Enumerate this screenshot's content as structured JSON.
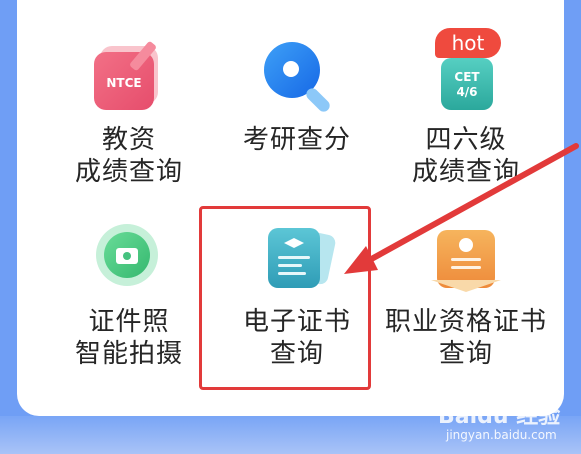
{
  "items": [
    {
      "id": "teacher-score",
      "line1": "教资",
      "line2": "成绩查询",
      "icon": "ntce-icon",
      "icon_text": "NTCE"
    },
    {
      "id": "grad-exam-score",
      "line1": "考研查分",
      "line2": "",
      "icon": "search-icon"
    },
    {
      "id": "cet-score",
      "line1": "四六级",
      "line2": "成绩查询",
      "icon": "cet-icon",
      "icon_text1": "CET",
      "icon_text2": "4/6",
      "badge": "hot"
    },
    {
      "id": "id-photo",
      "line1": "证件照",
      "line2": "智能拍摄",
      "icon": "camera-icon"
    },
    {
      "id": "e-certificate",
      "line1": "电子证书",
      "line2": "查询",
      "icon": "certificate-icon"
    },
    {
      "id": "vocational-certificate",
      "line1": "职业资格证书",
      "line2": "查询",
      "icon": "vocational-certificate-icon"
    }
  ],
  "colors": {
    "highlight": "#e23a3a",
    "background": "#6f9ef5"
  },
  "watermark": {
    "logo": "Baidu 经验",
    "url": "jingyan.baidu.com"
  }
}
